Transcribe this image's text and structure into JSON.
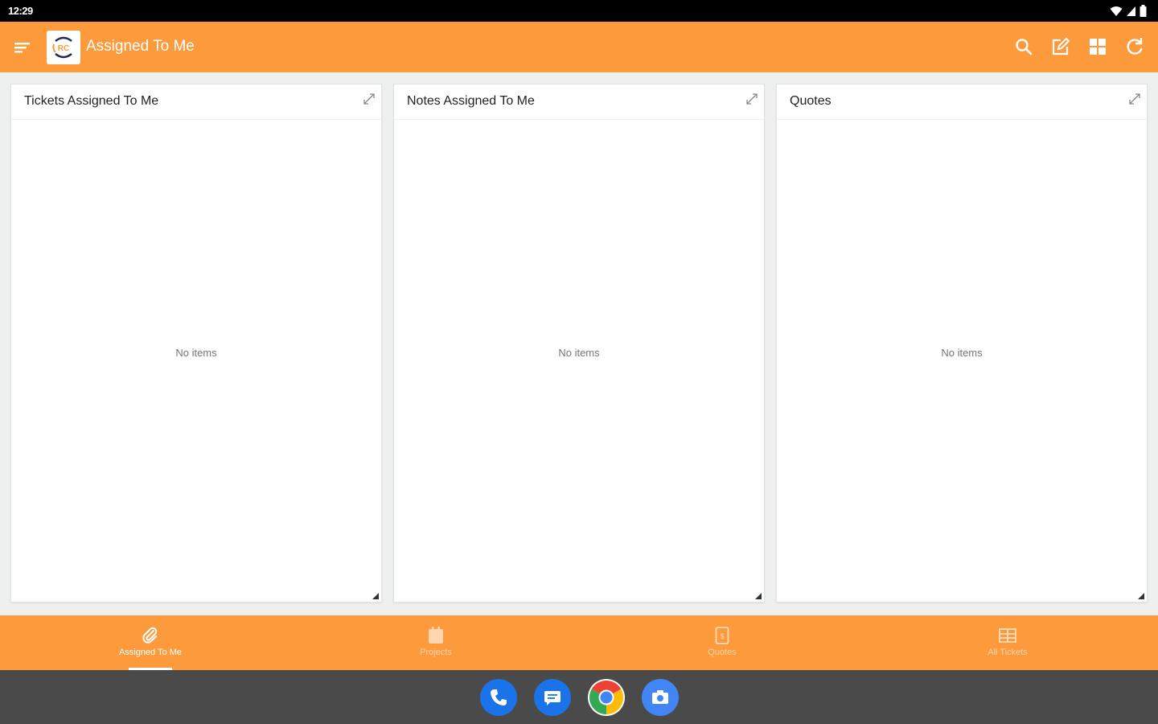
{
  "status_bar": {
    "time": "12:29"
  },
  "app_bar": {
    "title": "Assigned To Me",
    "logo_text": "RC",
    "actions": [
      "search-icon",
      "edit-icon",
      "grid-icon",
      "refresh-icon"
    ]
  },
  "panels": [
    {
      "title": "Tickets Assigned To Me",
      "empty_text": "No items"
    },
    {
      "title": "Notes Assigned To Me",
      "empty_text": "No items"
    },
    {
      "title": "Quotes",
      "empty_text": "No items"
    }
  ],
  "bottom_nav": {
    "items": [
      {
        "label": "Assigned To Me",
        "icon": "paperclip-icon",
        "active": true
      },
      {
        "label": "Projects",
        "icon": "calendar-icon",
        "active": false
      },
      {
        "label": "Quotes",
        "icon": "document-icon",
        "active": false
      },
      {
        "label": "All Tickets",
        "icon": "table-icon",
        "active": false
      }
    ]
  },
  "dock": {
    "apps": [
      "phone-icon",
      "messages-icon",
      "chrome-icon",
      "camera-icon"
    ]
  },
  "colors": {
    "accent": "#fd9a3c",
    "status_bar": "#000000",
    "dock": "#4a4a4a"
  }
}
